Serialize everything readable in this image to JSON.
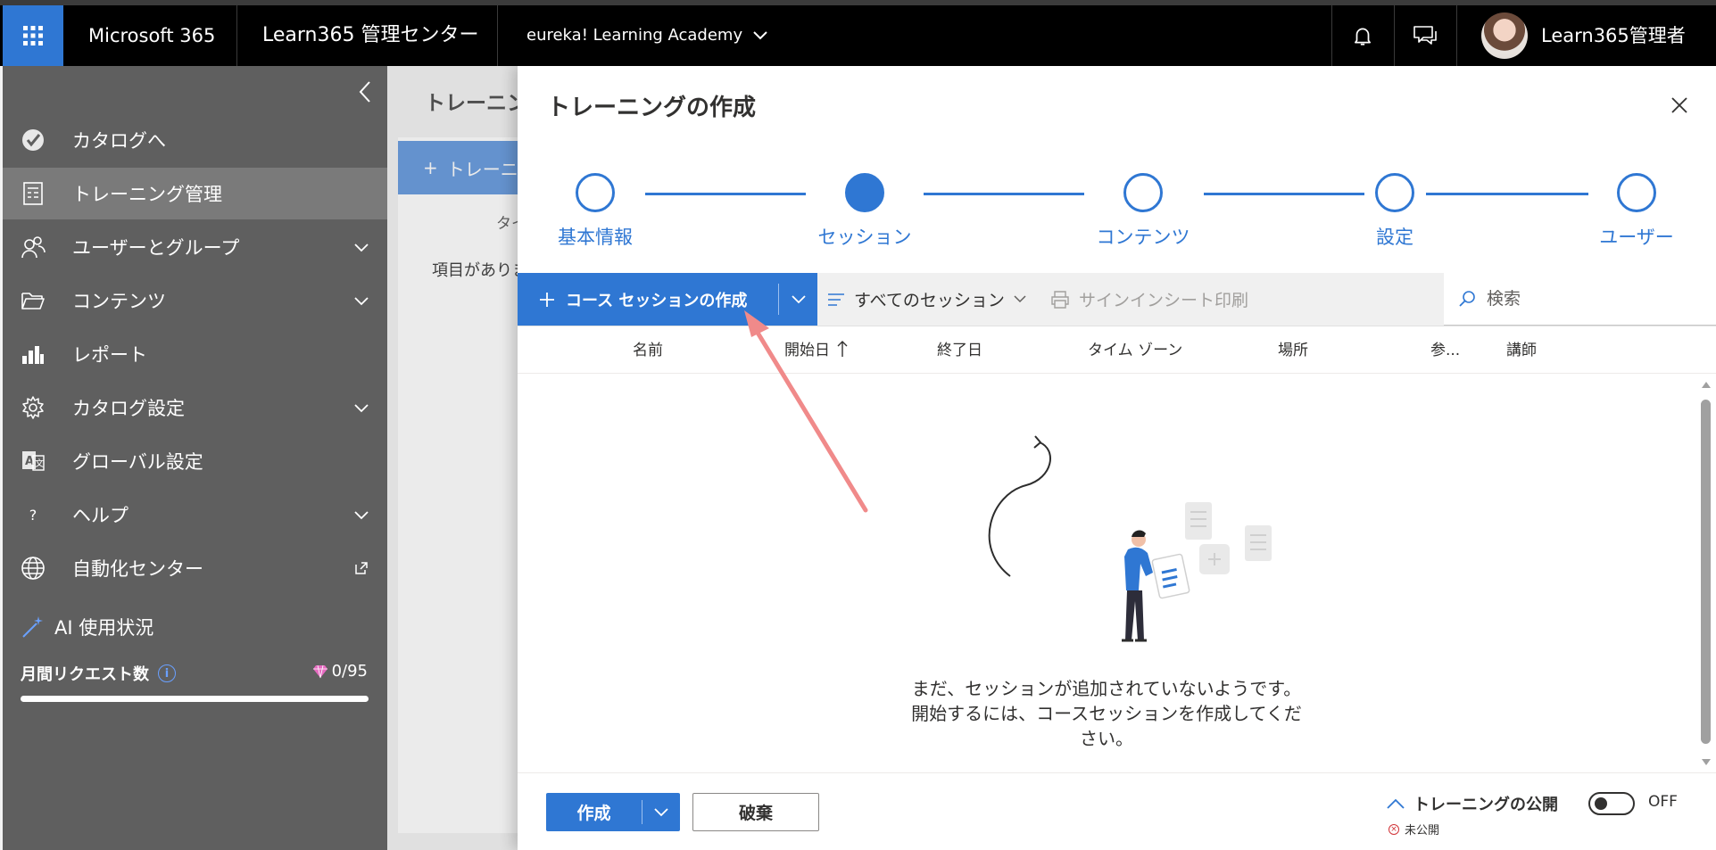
{
  "topbar": {
    "brand": "Microsoft 365",
    "app_name": "Learn365 管理センター",
    "tenant": "eureka! Learning Academy",
    "user_name": "Learn365管理者"
  },
  "sidebar": {
    "items": [
      {
        "label": "カタログへ",
        "icon": "catalog-icon"
      },
      {
        "label": "トレーニング管理",
        "icon": "training-icon",
        "active": true
      },
      {
        "label": "ユーザーとグループ",
        "icon": "users-icon",
        "expandable": true
      },
      {
        "label": "コンテンツ",
        "icon": "folder-icon",
        "expandable": true
      },
      {
        "label": "レポート",
        "icon": "chart-icon"
      },
      {
        "label": "カタログ設定",
        "icon": "gear-icon",
        "expandable": true
      },
      {
        "label": "グローバル設定",
        "icon": "translate-icon"
      },
      {
        "label": "ヘルプ",
        "icon": "help-icon",
        "expandable": true
      },
      {
        "label": "自動化センター",
        "icon": "globe-icon",
        "external": true
      }
    ],
    "ai_usage": {
      "title": "AI 使用状況",
      "request_label": "月間リクエスト数",
      "request_count": "0/95",
      "progress": 0.0
    }
  },
  "background_page": {
    "title": "トレーニング",
    "add_button": "トレーニ",
    "column": "タイ",
    "empty": "項目がありません"
  },
  "panel": {
    "title": "トレーニングの作成",
    "steps": [
      "基本情報",
      "セッション",
      "コンテンツ",
      "設定",
      "ユーザー"
    ],
    "current_step": 1,
    "toolbar": {
      "create_session": "コース セッションの作成",
      "filter": "すべてのセッション",
      "print": "サインインシート印刷",
      "search_placeholder": "検索"
    },
    "columns": [
      "名前",
      "開始日",
      "終了日",
      "タイム ゾーン",
      "場所",
      "参...",
      "講師"
    ],
    "empty_message": "まだ、セッションが追加されていないようです。開始するには、コースセッションを作成してください。",
    "footer": {
      "save": "作成",
      "discard": "破棄",
      "publish_label": "トレーニングの公開",
      "publish_status": "未公開",
      "toggle_state": "OFF"
    }
  },
  "colors": {
    "accent": "#2f77d3",
    "annotation_arrow": "#f08a8a",
    "nav_bg": "#5f5f5f"
  }
}
